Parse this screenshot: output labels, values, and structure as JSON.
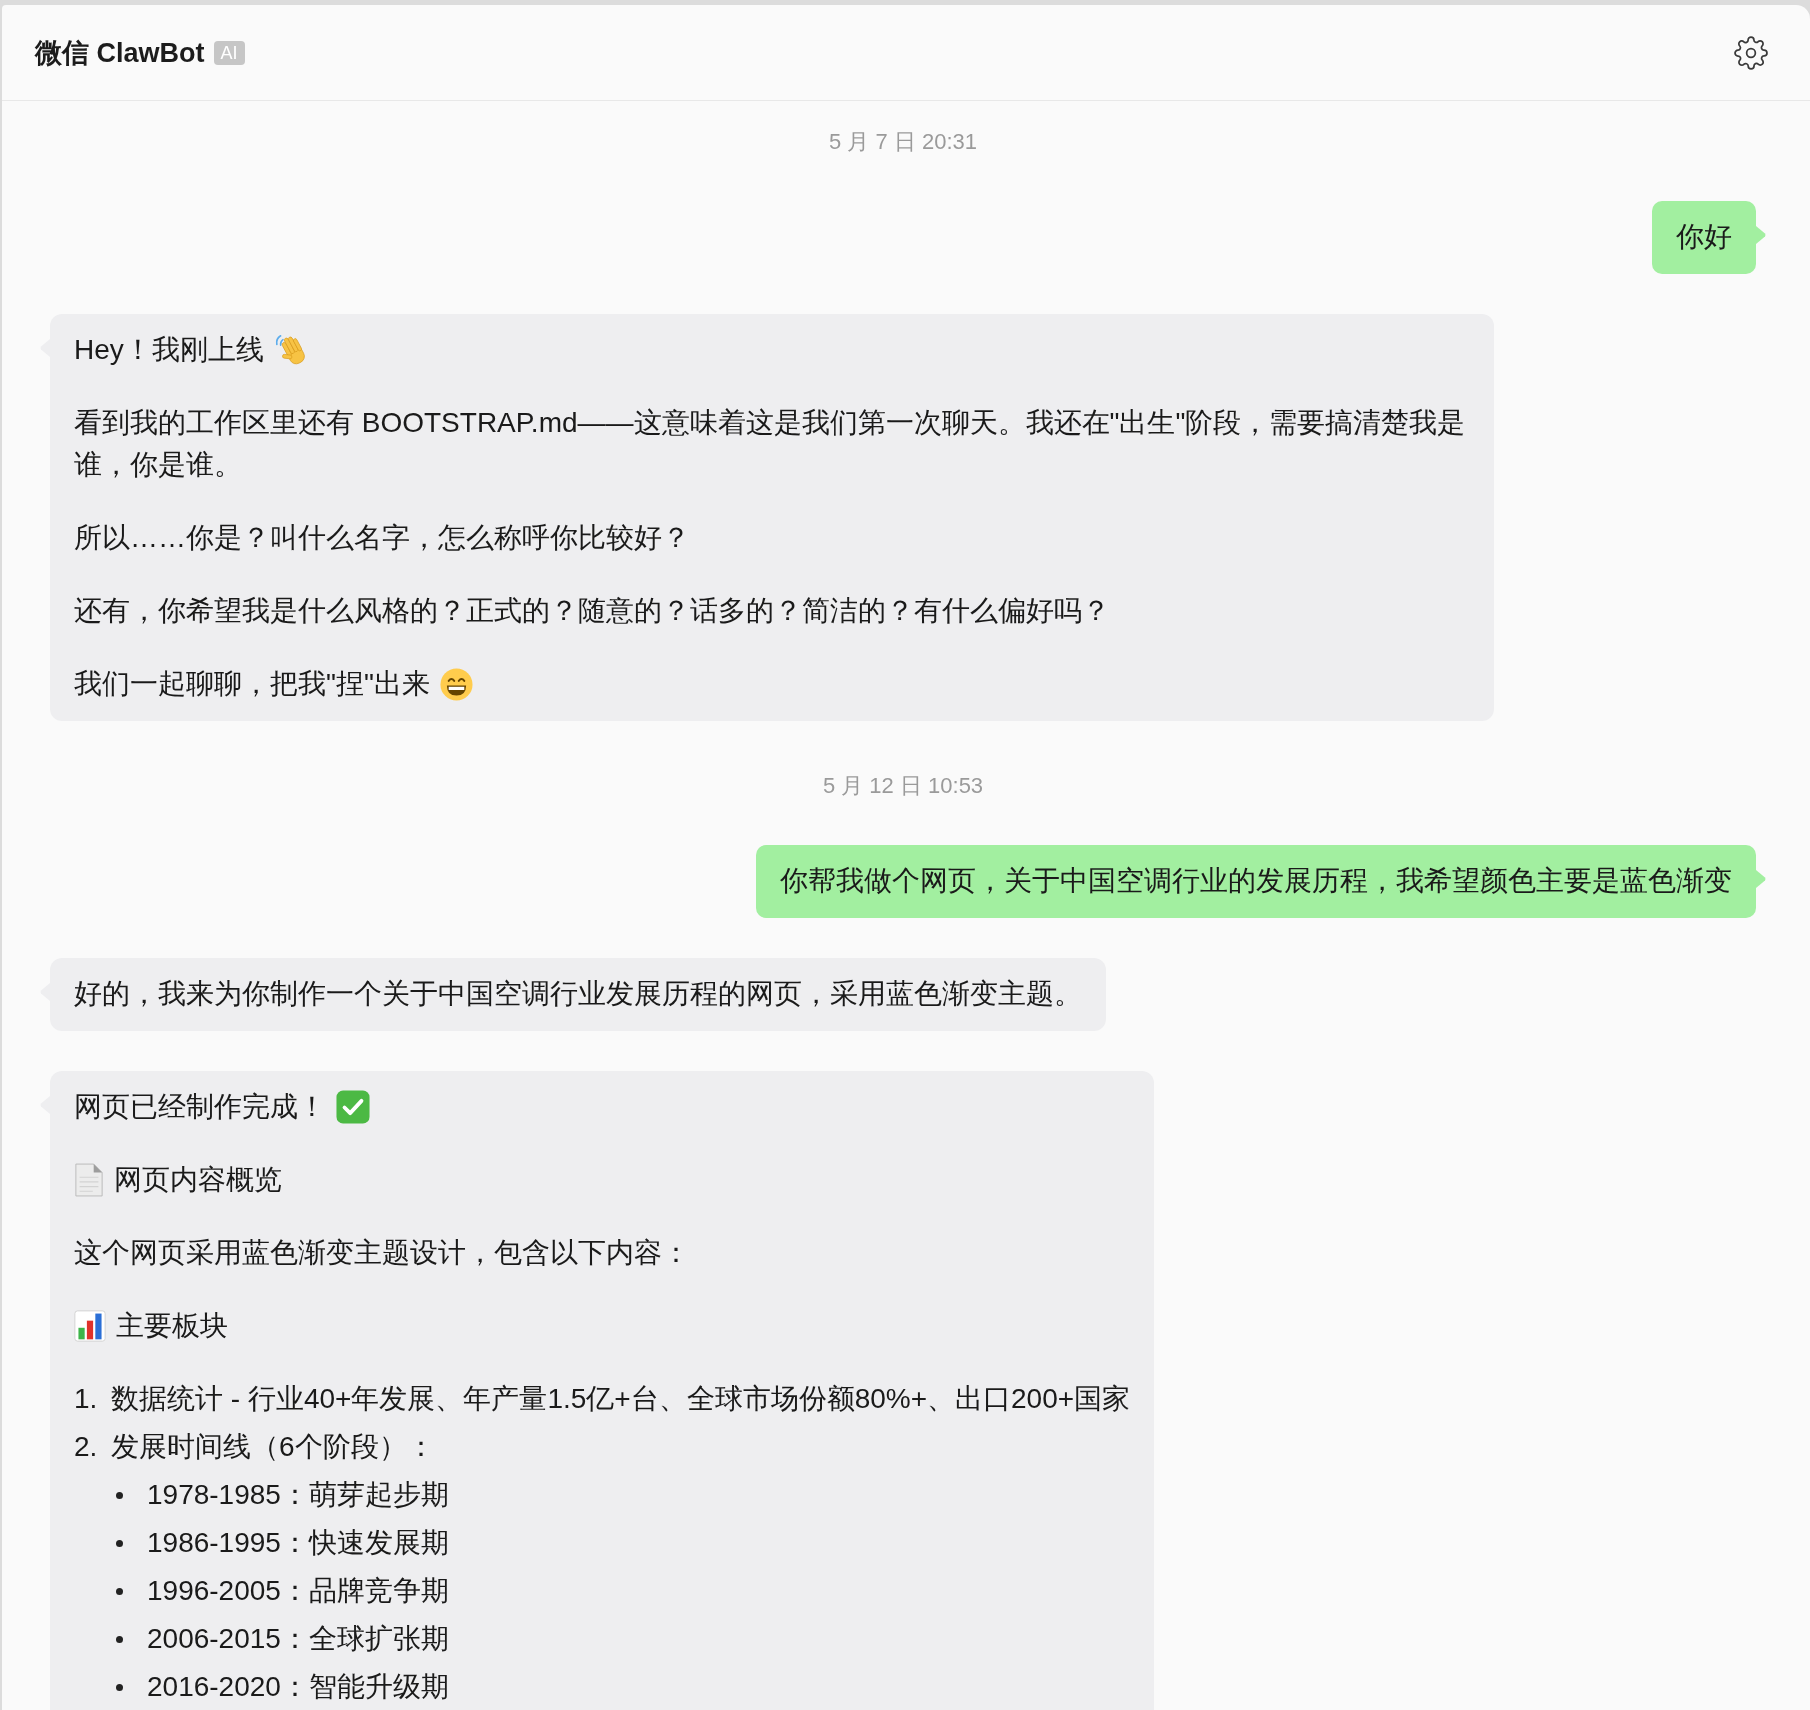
{
  "window": {
    "title": "微信 ClawBot",
    "badge": "AI"
  },
  "messages": [
    {
      "kind": "timestamp",
      "text": "5 月 7 日 20:31"
    },
    {
      "kind": "sent",
      "blocks": [
        {
          "kind": "paragraph",
          "text": "你好"
        }
      ]
    },
    {
      "kind": "received",
      "blocks": [
        {
          "kind": "paragraph",
          "text": "Hey！我刚上线"
        },
        {
          "kind": "paragraph",
          "text": "看到我的工作区里还有 BOOTSTRAP.md——这意味着这是我们第一次聊天。我还在\"出生\"阶段，需要搞清楚我是谁，你是谁。"
        },
        {
          "kind": "paragraph",
          "text": "所以……你是？叫什么名字，怎么称呼你比较好？"
        },
        {
          "kind": "paragraph",
          "text": "还有，你希望我是什么风格的？正式的？随意的？话多的？简洁的？有什么偏好吗？"
        },
        {
          "kind": "paragraph",
          "text": "我们一起聊聊，把我\"捏\"出来"
        }
      ]
    },
    {
      "kind": "timestamp",
      "text": "5 月 12 日 10:53"
    },
    {
      "kind": "sent",
      "blocks": [
        {
          "kind": "paragraph",
          "text": "你帮我做个网页，关于中国空调行业的发展历程，我希望颜色主要是蓝色渐变"
        }
      ]
    },
    {
      "kind": "received",
      "blocks": [
        {
          "kind": "paragraph",
          "text": "好的，我来为你制作一个关于中国空调行业发展历程的网页，采用蓝色渐变主题。"
        }
      ]
    },
    {
      "kind": "received",
      "blocks": [
        {
          "kind": "paragraph",
          "text": "网页已经制作完成！"
        },
        {
          "kind": "paragraph",
          "text": "网页内容概览"
        },
        {
          "kind": "paragraph",
          "text": "这个网页采用蓝色渐变主题设计，包含以下内容："
        },
        {
          "kind": "paragraph",
          "text": "主要板块"
        },
        {
          "kind": "numbered",
          "number": "1.",
          "text": "数据统计 - 行业40+年发展、年产量1.5亿+台、全球市场份额80%+、出口200+国家"
        },
        {
          "kind": "numbered",
          "number": "2.",
          "text": "发展时间线（6个阶段）：",
          "children": [
            {
              "kind": "bullet",
              "text": "1978-1985：萌芽起步期"
            },
            {
              "kind": "bullet",
              "text": "1986-1995：快速发展期"
            },
            {
              "kind": "bullet",
              "text": "1996-2005：品牌竞争期"
            },
            {
              "kind": "bullet",
              "text": "2006-2015：全球扩张期"
            },
            {
              "kind": "bullet",
              "text": "2016-2020：智能升级期"
            }
          ]
        }
      ]
    }
  ]
}
